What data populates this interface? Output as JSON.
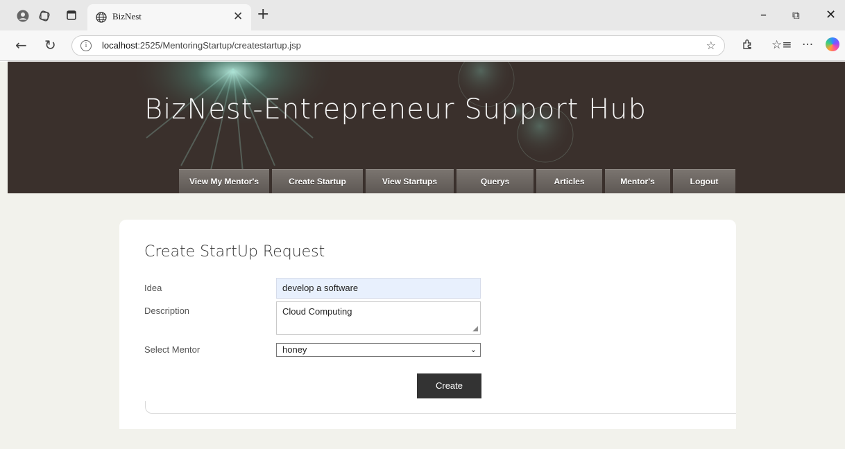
{
  "browser": {
    "tab_title": "BizNest",
    "url_host": "localhost",
    "url_path": ":2525/MentoringStartup/createstartup.jsp"
  },
  "site": {
    "title": "BizNest-Entrepreneur Support Hub"
  },
  "menu": {
    "items": [
      "View My Mentor's",
      "Create Startup",
      "View Startups",
      "Querys",
      "Articles",
      "Mentor's",
      "Logout"
    ]
  },
  "form": {
    "title": "Create StartUp Request",
    "idea_label": "Idea",
    "idea_value": "develop a software",
    "description_label": "Description",
    "description_value": "Cloud Computing",
    "mentor_label": "Select Mentor",
    "mentor_value": "honey",
    "submit_label": "Create"
  },
  "colors": {
    "header_bg": "#3a302c",
    "page_bg": "#f2f2ec",
    "button_bg": "#333333",
    "autofill_bg": "#e8f0fd"
  }
}
